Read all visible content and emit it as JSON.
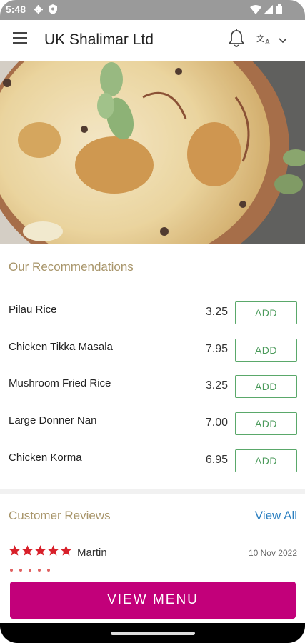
{
  "status_bar": {
    "time": "5:48",
    "icons": [
      "gear-icon",
      "shield-icon",
      "wifi-icon",
      "signal-icon",
      "battery-icon"
    ]
  },
  "app_bar": {
    "title": "UK Shalimar Ltd",
    "icons": [
      "menu-icon",
      "bell-icon",
      "language-icon",
      "chevron-down-icon"
    ]
  },
  "recommendations": {
    "title": "Our Recommendations",
    "add_label": "ADD",
    "items": [
      {
        "name": "Pilau Rice",
        "price": "3.25"
      },
      {
        "name": "Chicken Tikka Masala",
        "price": "7.95"
      },
      {
        "name": "Mushroom Fried Rice",
        "price": "3.25"
      },
      {
        "name": "Large Donner Nan",
        "price": "7.00"
      },
      {
        "name": "Chicken Korma",
        "price": "6.95"
      }
    ]
  },
  "reviews": {
    "title": "Customer Reviews",
    "view_all": "View All",
    "items": [
      {
        "rating": 5,
        "author": "Martin",
        "date": "10 Nov 2022"
      }
    ]
  },
  "view_menu_label": "VIEW MENU",
  "colors": {
    "accent_gold": "#a8956a",
    "add_green": "#4a9a5a",
    "link_blue": "#2b7fc0",
    "star_red": "#d8202a",
    "cta_magenta": "#c2007a"
  }
}
